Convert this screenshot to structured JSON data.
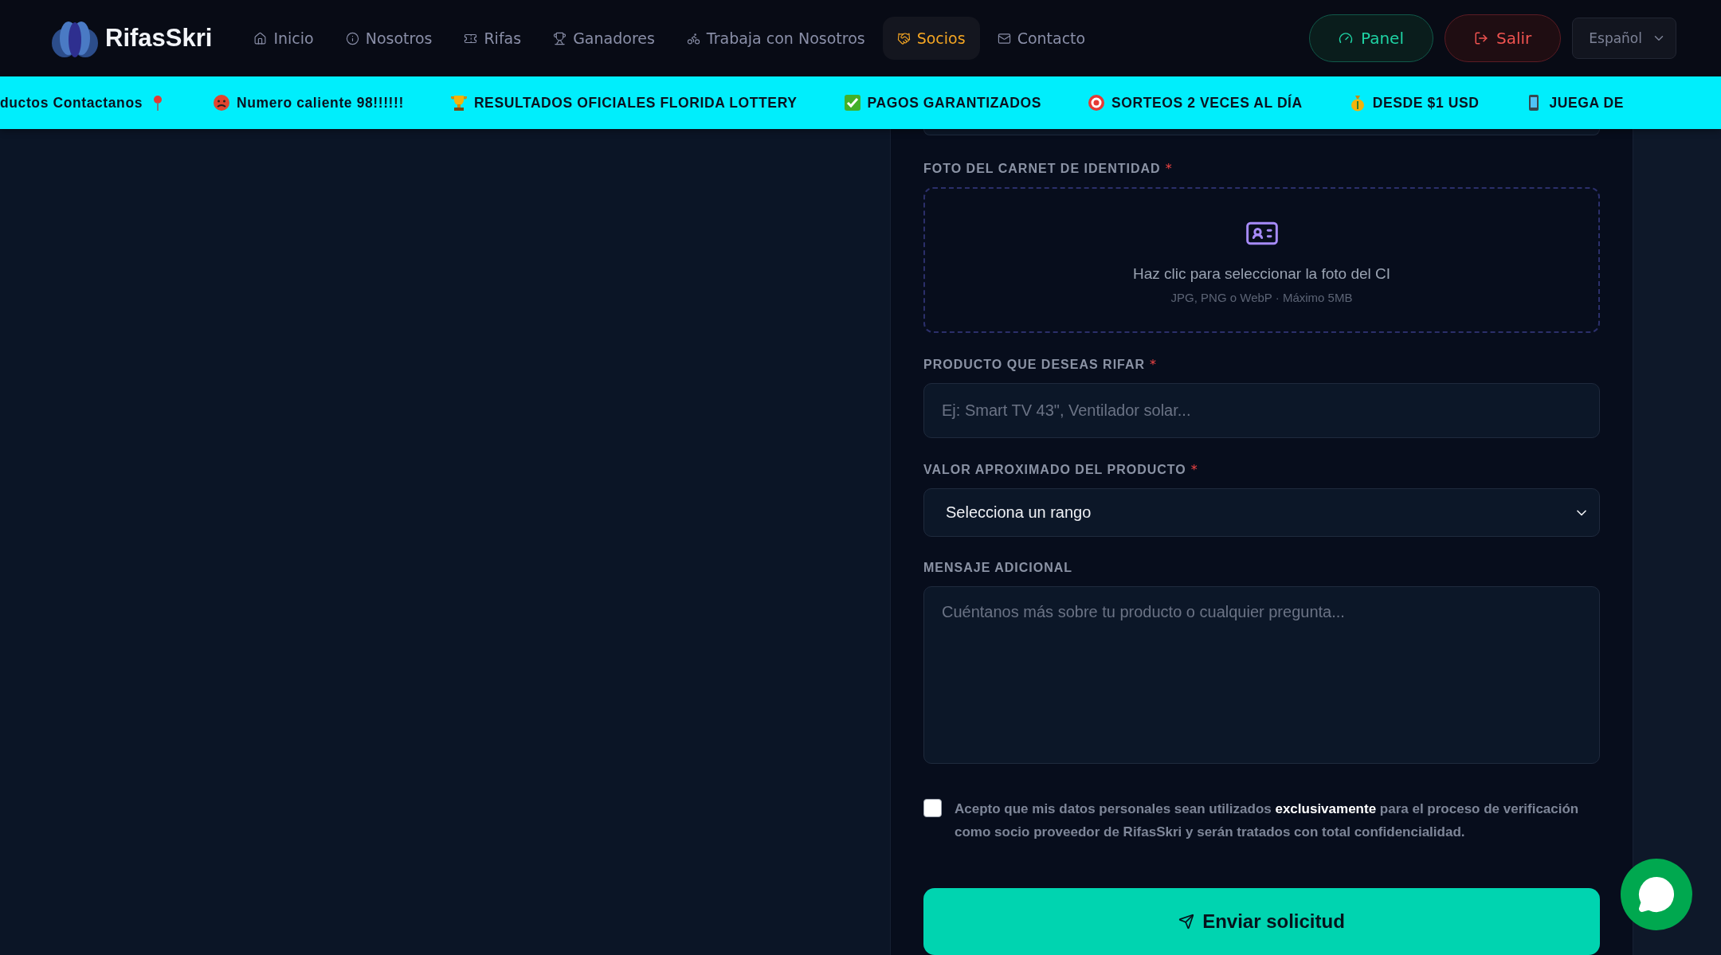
{
  "header": {
    "logo": "RifasSkri",
    "nav": [
      {
        "label": "Inicio",
        "selected": false
      },
      {
        "label": "Nosotros",
        "selected": false
      },
      {
        "label": "Rifas",
        "selected": false
      },
      {
        "label": "Ganadores",
        "selected": false
      },
      {
        "label": "Trabaja con Nosotros",
        "selected": false
      },
      {
        "label": "Socios",
        "selected": true
      },
      {
        "label": "Contacto",
        "selected": false
      }
    ],
    "panel_button": "Panel",
    "logout_button": "Salir",
    "language": "Español"
  },
  "ticker": [
    {
      "text": "ductos Contactanos"
    },
    {
      "text": "Numero caliente 98!!!!!!"
    },
    {
      "text": "RESULTADOS OFICIALES FLORIDA LOTTERY"
    },
    {
      "text": "PAGOS GARANTIZADOS"
    },
    {
      "text": "SORTEOS 2 VECES AL DÍA"
    },
    {
      "text": "DESDE $1 USD"
    },
    {
      "text": "JUEGA DE"
    }
  ],
  "form": {
    "fields": [
      {
        "kind": "cut_input"
      },
      {
        "kind": "upload",
        "label": "FOTO DEL CARNET DE IDENTIDAD",
        "required_mark": "*",
        "prompt": "Haz clic para seleccionar la foto del CI",
        "hint": "JPG, PNG o WebP · Máximo 5MB"
      },
      {
        "kind": "input",
        "label": "PRODUCTO QUE DESEAS RIFAR",
        "required_mark": "*",
        "placeholder": "Ej: Smart TV 43\", Ventilador solar..."
      },
      {
        "kind": "select",
        "label": "VALOR APROXIMADO DEL PRODUCTO",
        "required_mark": "*",
        "value": "Selecciona un rango"
      },
      {
        "kind": "textarea",
        "label": "MENSAJE ADICIONAL",
        "placeholder": "Cuéntanos más sobre tu producto o cualquier pregunta..."
      }
    ],
    "consent": {
      "checked": false,
      "text": "Acepto que mis datos personales sean utilizados **exclusivamente** para el proceso de verificación como socio proveedor de RifasSkri y serán tratados con total confidencialidad."
    },
    "submit": "Enviar solicitud"
  }
}
